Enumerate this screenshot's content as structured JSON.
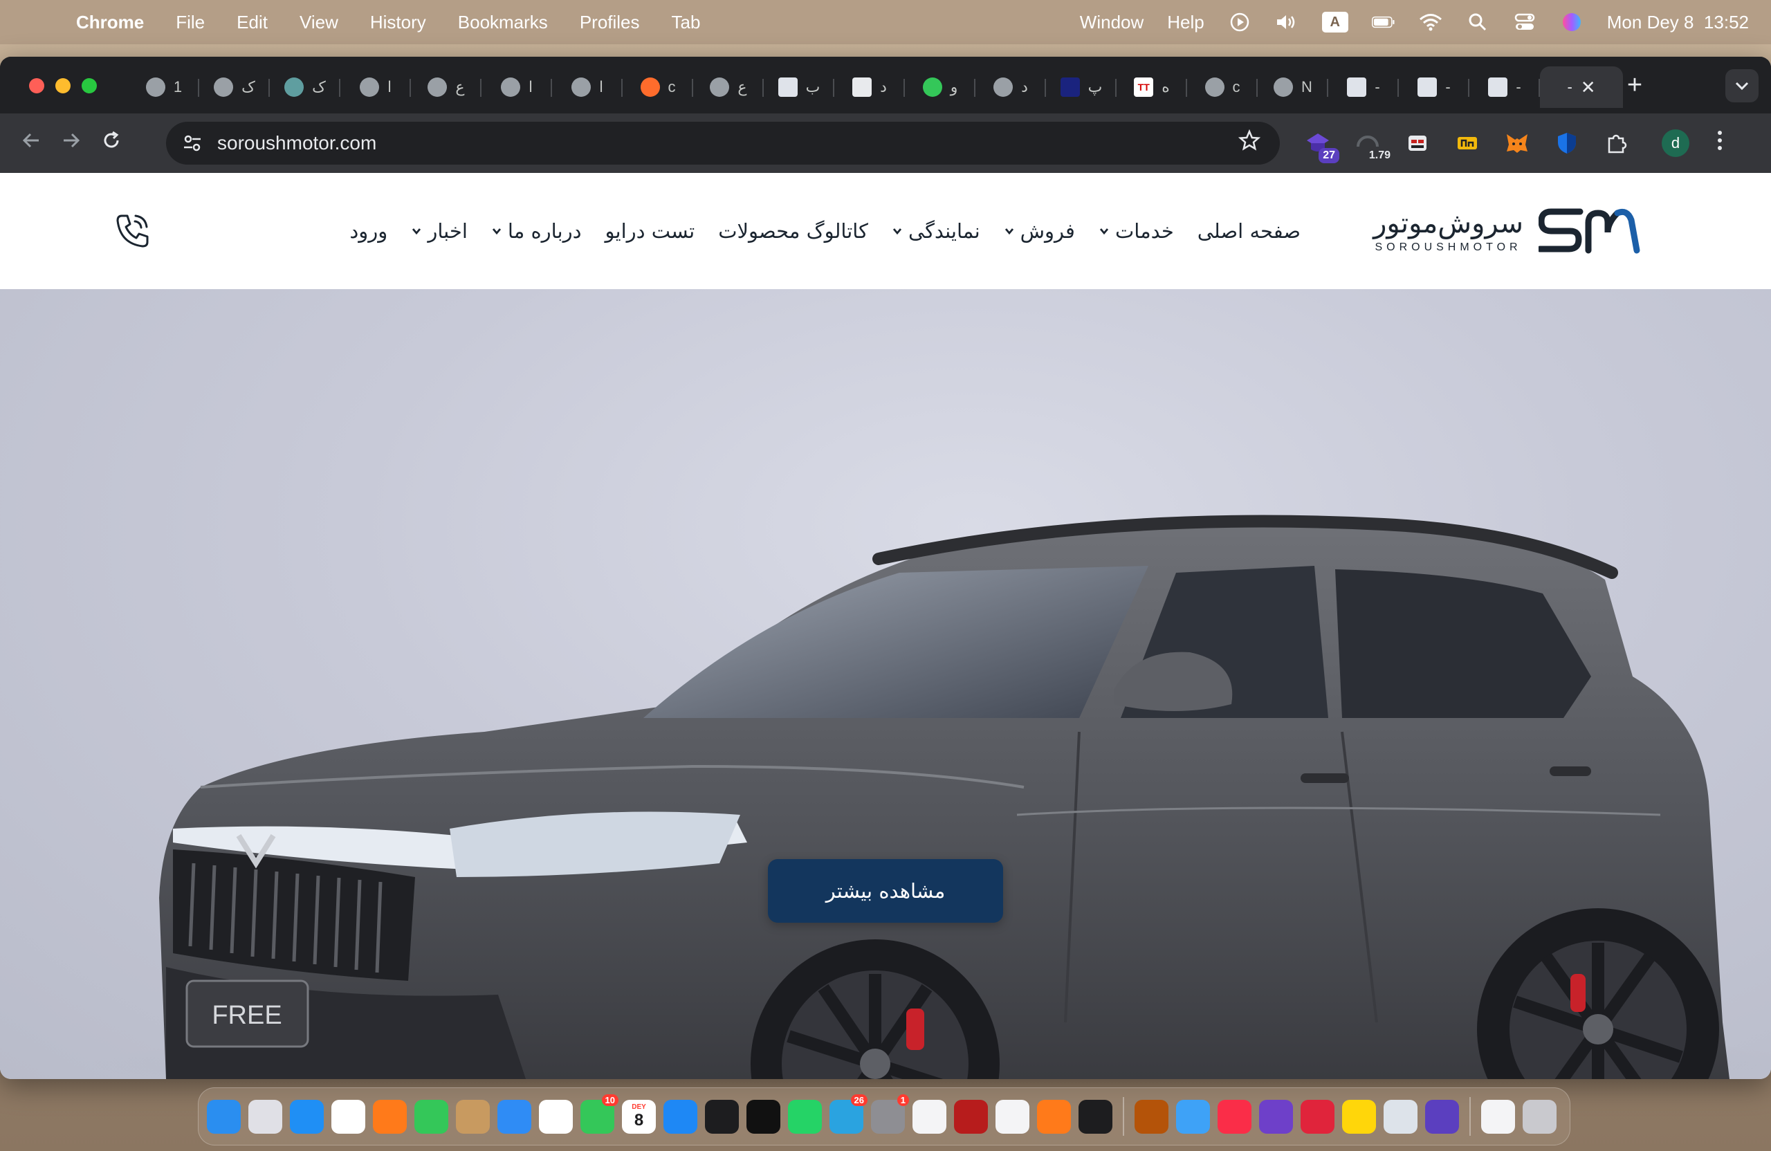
{
  "menubar": {
    "app_name": "Chrome",
    "items": [
      "File",
      "Edit",
      "View",
      "History",
      "Bookmarks",
      "Profiles",
      "Tab",
      "Window",
      "Help"
    ],
    "input_source": "A",
    "datetime": "Mon Dey 8  13:52"
  },
  "browser": {
    "tabs": [
      {
        "fav": "globe-icon",
        "label": "1"
      },
      {
        "fav": "globe-icon",
        "label": "ک"
      },
      {
        "fav": "target-icon",
        "label": "ک"
      },
      {
        "fav": "globe-icon",
        "label": "ا"
      },
      {
        "fav": "globe-icon",
        "label": "ع"
      },
      {
        "fav": "globe-icon",
        "label": "ا"
      },
      {
        "fav": "globe-icon",
        "label": "ا"
      },
      {
        "fav": "cpanel-icon",
        "label": "c"
      },
      {
        "fav": "globe-icon",
        "label": "ع"
      },
      {
        "fav": "sm-logo-icon",
        "label": "ب"
      },
      {
        "fav": "doc-icon",
        "label": "د"
      },
      {
        "fav": "chat-icon",
        "label": "و"
      },
      {
        "fav": "globe-icon",
        "label": "د"
      },
      {
        "fav": "square-icon",
        "label": "پ"
      },
      {
        "fav": "tt-icon",
        "label": "ه"
      },
      {
        "fav": "globe-icon",
        "label": "c"
      },
      {
        "fav": "chrome-icon",
        "label": "N"
      },
      {
        "fav": "sm-logo-icon",
        "label": "-"
      },
      {
        "fav": "sm-logo-icon",
        "label": "-"
      },
      {
        "fav": "sm-logo-icon",
        "label": "-"
      }
    ],
    "active_tab_label": "-",
    "url": "soroushmotor.com",
    "extensions": [
      {
        "name": "extension-a",
        "badge": "27"
      },
      {
        "name": "extension-b",
        "badge": "1.79"
      }
    ],
    "profile_initial": "d"
  },
  "site": {
    "logo_fa": "سروش‌موتور",
    "logo_en": "SOROUSHMOTOR",
    "nav": [
      {
        "label": "صفحه اصلی",
        "dropdown": false
      },
      {
        "label": "خدمات",
        "dropdown": true
      },
      {
        "label": "فروش",
        "dropdown": true
      },
      {
        "label": "نمایندگی",
        "dropdown": true
      },
      {
        "label": "کاتالوگ محصولات",
        "dropdown": false
      },
      {
        "label": "تست درایو",
        "dropdown": false
      },
      {
        "label": "درباره ما",
        "dropdown": true
      },
      {
        "label": "اخبار",
        "dropdown": true
      },
      {
        "label": "ورود",
        "dropdown": false
      }
    ],
    "hero": {
      "badge_text": "FREE",
      "cta_label": "مشاهده بیشتر"
    }
  },
  "dock": {
    "apps": [
      {
        "name": "finder",
        "color": "#2a8ef0"
      },
      {
        "name": "launchpad",
        "color": "#e0e0e6"
      },
      {
        "name": "safari",
        "color": "#1f8ff5"
      },
      {
        "name": "chrome",
        "color": "#ffffff"
      },
      {
        "name": "firefox",
        "color": "#ff7a1a"
      },
      {
        "name": "messages",
        "color": "#34c759"
      },
      {
        "name": "contacts",
        "color": "#c89a60"
      },
      {
        "name": "mail",
        "color": "#2f8cf5"
      },
      {
        "name": "photos",
        "color": "#ffffff"
      },
      {
        "name": "facetime",
        "color": "#34c759",
        "badge": "10"
      },
      {
        "name": "calendar",
        "color": "#ffffff",
        "month": "DEY",
        "day": "8"
      },
      {
        "name": "app-store",
        "color": "#1e88f5"
      },
      {
        "name": "terminal",
        "color": "#1d1d1f"
      },
      {
        "name": "v2box",
        "color": "#111111"
      },
      {
        "name": "whatsapp",
        "color": "#25d366"
      },
      {
        "name": "telegram",
        "color": "#2aa3e0",
        "badge": "26"
      },
      {
        "name": "system-settings",
        "color": "#8e8e93",
        "badge": "1"
      },
      {
        "name": "vscode",
        "color": "#f4f4f6"
      },
      {
        "name": "filezilla",
        "color": "#b71c1c"
      },
      {
        "name": "windows-app",
        "color": "#f4f4f6"
      },
      {
        "name": "sketch",
        "color": "#ff7a1a"
      },
      {
        "name": "activity-monitor",
        "color": "#1d1d1f"
      },
      {
        "name": "transmission",
        "color": "#b45309"
      },
      {
        "name": "icloud",
        "color": "#3ea2f7"
      },
      {
        "name": "music",
        "color": "#fa2d48"
      },
      {
        "name": "github-desktop",
        "color": "#6e40c9"
      },
      {
        "name": "screen-recorder",
        "color": "#e0243b"
      },
      {
        "name": "notes",
        "color": "#ffd60a"
      },
      {
        "name": "preview",
        "color": "#dde3ea"
      },
      {
        "name": "arc",
        "color": "#5b3fbf"
      },
      {
        "name": "documents",
        "color": "#f4f4f6"
      },
      {
        "name": "trash",
        "color": "#c9c9ce"
      }
    ]
  }
}
